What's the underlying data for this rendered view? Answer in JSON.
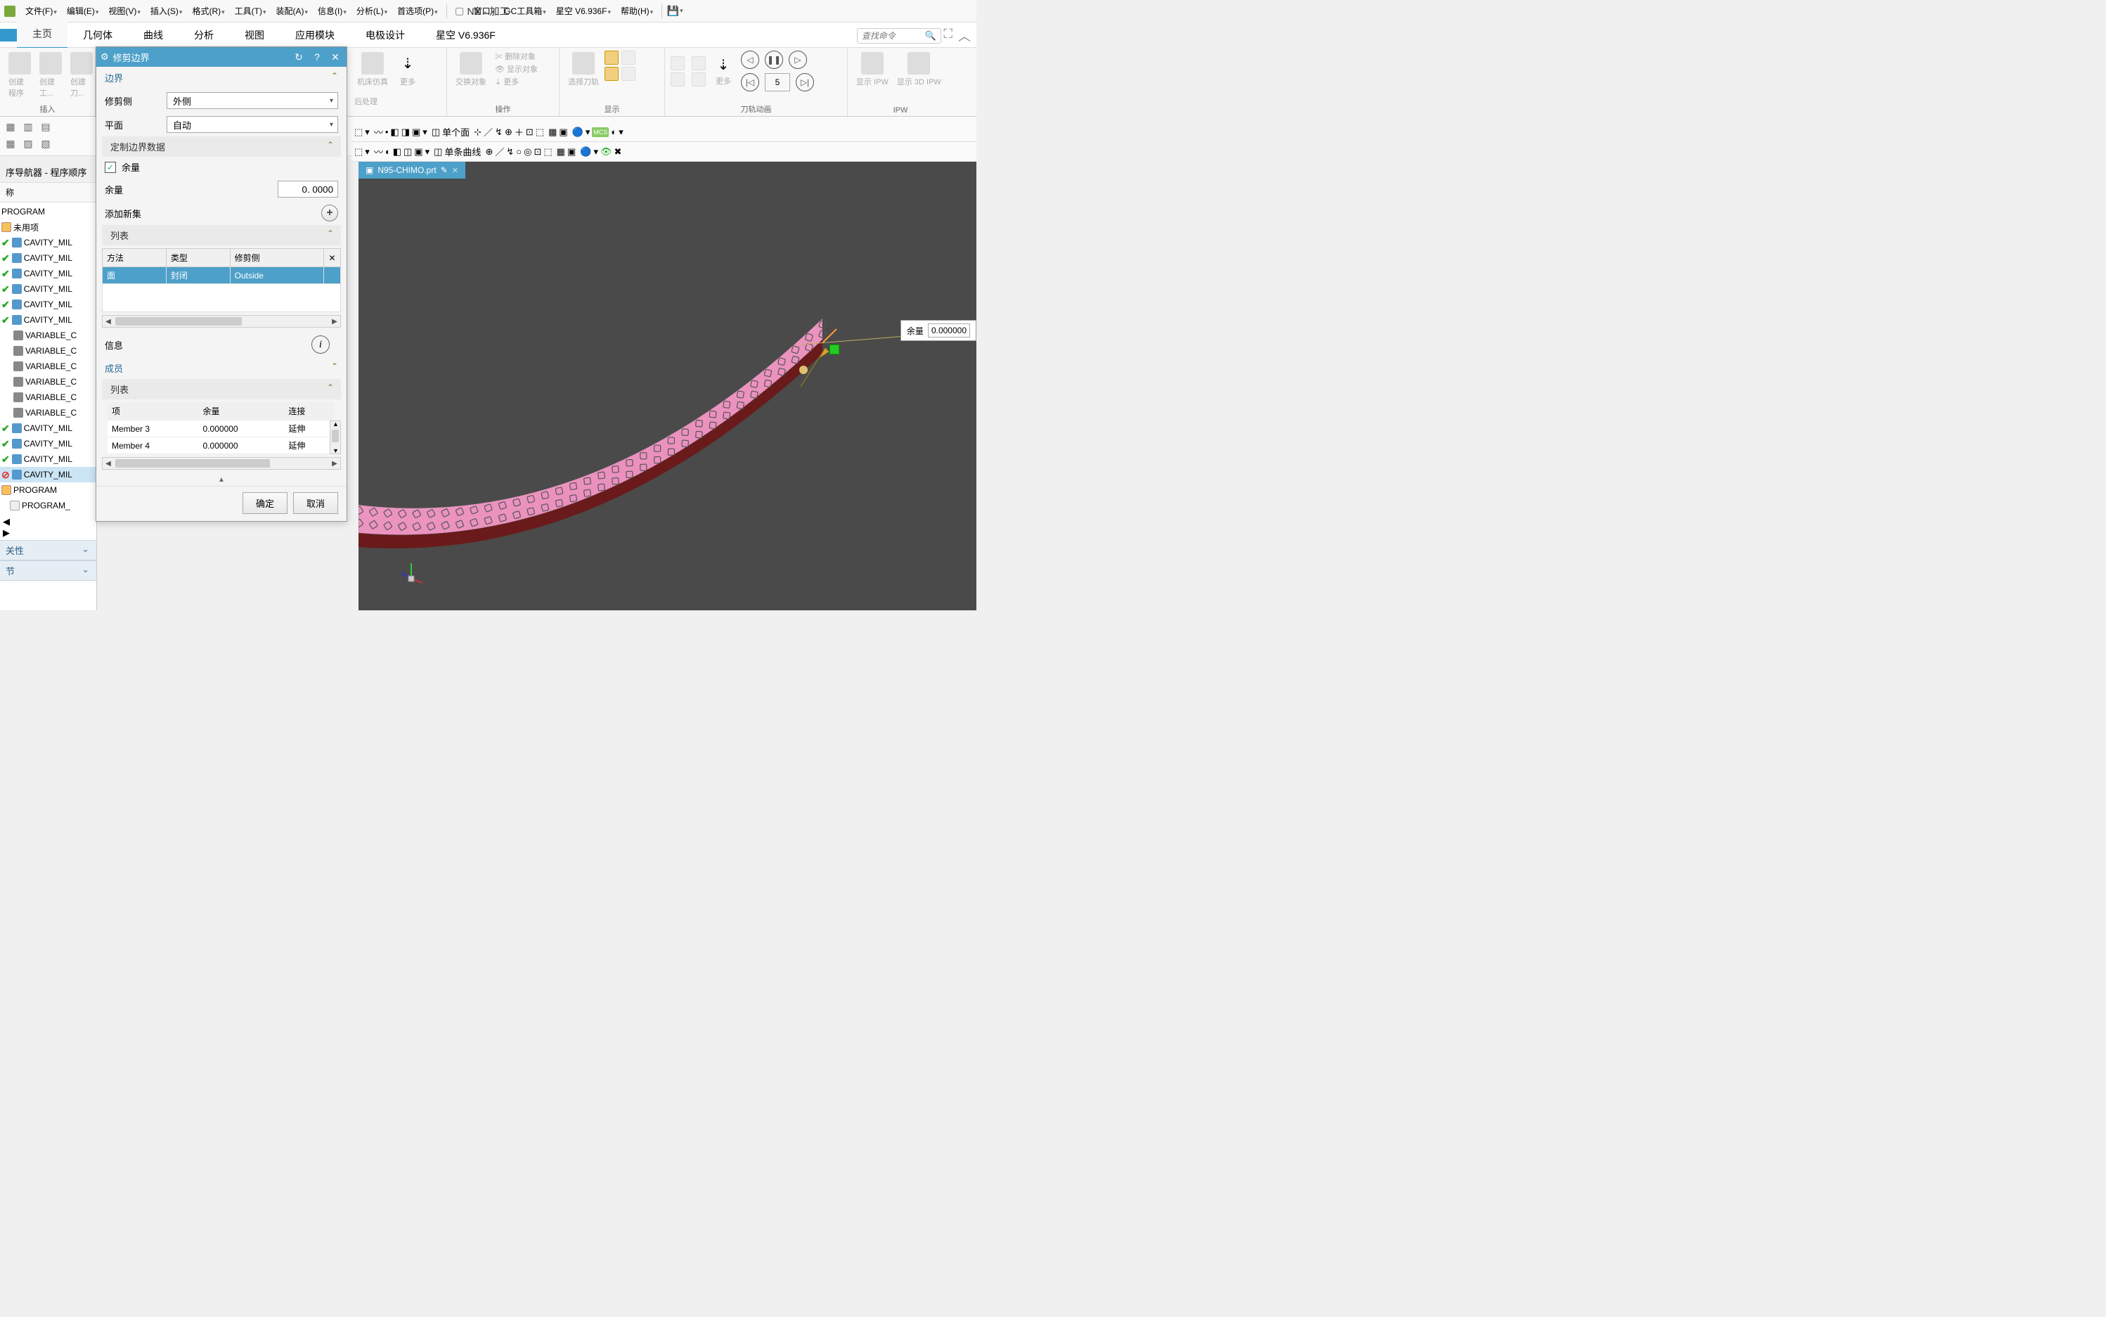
{
  "app_title": "NX - 加工",
  "menubar": [
    "文件(F)",
    "编辑(E)",
    "视图(V)",
    "插入(S)",
    "格式(R)",
    "工具(T)",
    "装配(A)",
    "信息(I)",
    "分析(L)",
    "首选项(P)",
    "窗口",
    "GC工具箱",
    "星空 V6.936F",
    "帮助(H)"
  ],
  "ribbon_tabs": [
    "",
    "主页",
    "几何体",
    "曲线",
    "分析",
    "视图",
    "应用模块",
    "电极设计",
    "星空 V6.936F"
  ],
  "search_placeholder": "查找命令",
  "ribbon_groups": {
    "g1_btn1": "创建程序",
    "g1_btn2": "创建工...",
    "g1_btn3": "创建刀...",
    "g1_label": "插入",
    "g2_btn1": "机床仿真",
    "g2_btn2": "后处理",
    "g2_more": "更多",
    "g3_btn1": "交换对象",
    "g3_btn2": "删除对象",
    "g3_btn3": "显示对象",
    "g3_more": "更多",
    "g3_label": "操作",
    "g4_btn1": "选择刀轨",
    "g4_label": "显示",
    "g5_more": "更多",
    "g5_label": "刀轨动画",
    "g5_speed": "5",
    "g6_btn1": "显示 IPW",
    "g6_btn2": "显示 3D IPW",
    "g6_label": "IPW"
  },
  "sec_combo1": "单个面",
  "sec_combo2": "单条曲线",
  "left": {
    "header": "序导航器 - 程序顺序",
    "col": "称",
    "root": "PROGRAM",
    "unused": "未用项",
    "items": [
      "CAVITY_MIL",
      "CAVITY_MIL",
      "CAVITY_MIL",
      "CAVITY_MIL",
      "CAVITY_MIL",
      "CAVITY_MIL",
      "VARIABLE_C",
      "VARIABLE_C",
      "VARIABLE_C",
      "VARIABLE_C",
      "VARIABLE_C",
      "VARIABLE_C",
      "CAVITY_MIL",
      "CAVITY_MIL",
      "CAVITY_MIL",
      "CAVITY_MIL"
    ],
    "prog": "PROGRAM",
    "prog_item": "PROGRAM_",
    "sec_dep": "关性",
    "sec_detail": "节"
  },
  "dialog": {
    "title": "修剪边界",
    "sec_boundary": "边界",
    "trim_side_label": "修剪侧",
    "trim_side_value": "外侧",
    "plane_label": "平面",
    "plane_value": "自动",
    "custom_data": "定制边界数据",
    "allow_label": "余量",
    "allow_chk_label": "余量",
    "allow_value": "0. 0000",
    "add_new": "添加新集",
    "list": "列表",
    "th_method": "方法",
    "th_type": "类型",
    "th_side": "修剪侧",
    "row_method": "面",
    "row_type": "封闭",
    "row_side": "Outside",
    "info": "信息",
    "members": "成员",
    "mth_item": "项",
    "mth_allow": "余量",
    "mth_conn": "连接",
    "m1_item": "Member 3",
    "m1_allow": "0.000000",
    "m1_conn": "延伸",
    "m2_item": "Member 4",
    "m2_allow": "0.000000",
    "m2_conn": "延伸",
    "ok": "确定",
    "cancel": "取消"
  },
  "viewport": {
    "tab": "N95-CHIMO.prt",
    "float_label": "余量",
    "float_value": "0.000000"
  }
}
